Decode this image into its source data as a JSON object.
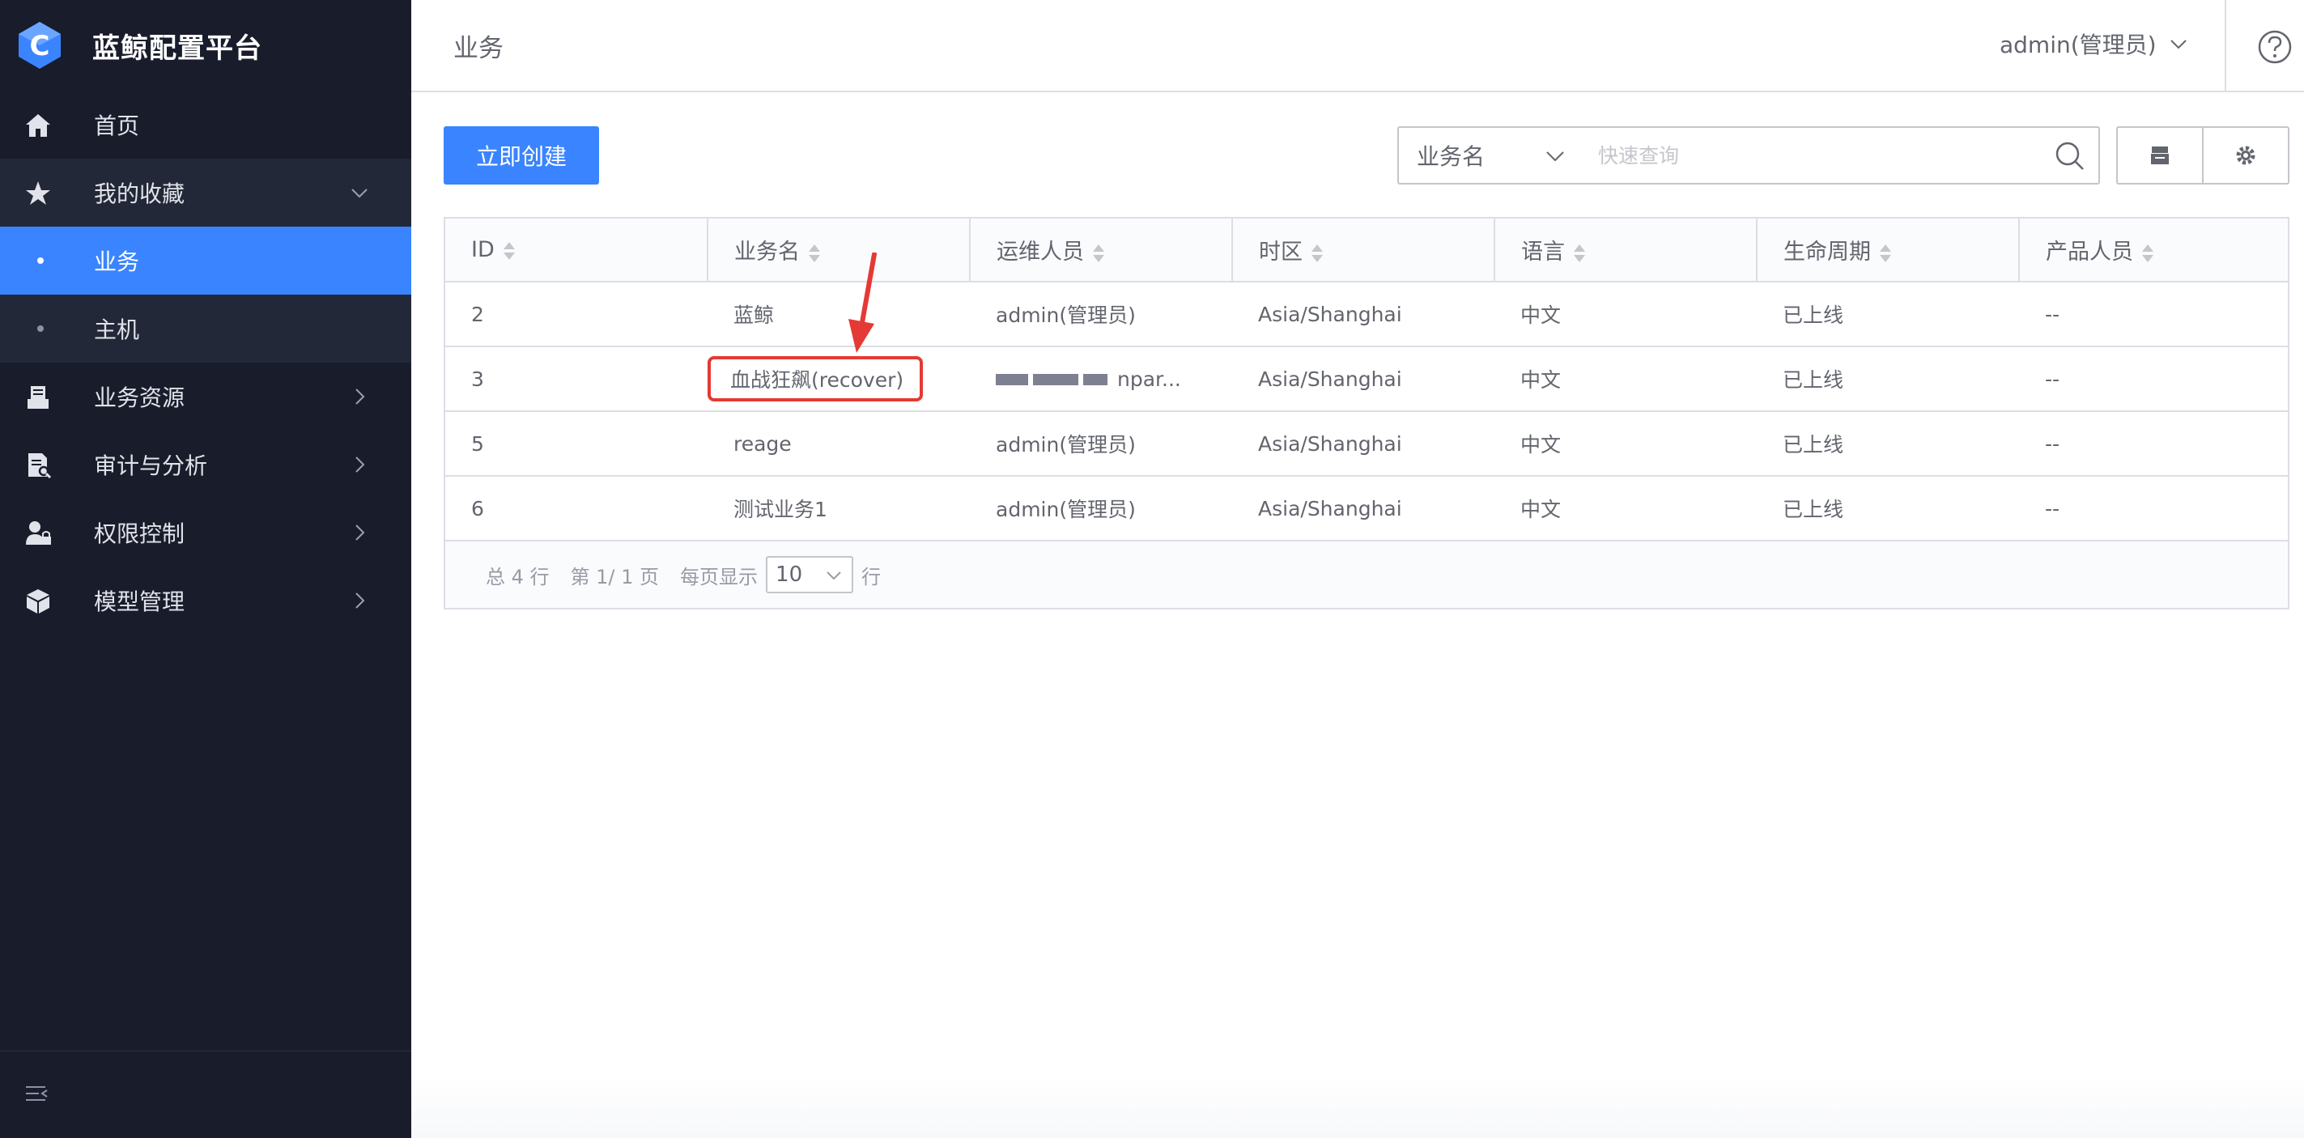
{
  "app": {
    "title": "蓝鲸配置平台"
  },
  "sidebar": {
    "items": [
      {
        "label": "首页",
        "icon": "home-icon"
      },
      {
        "label": "我的收藏",
        "icon": "star-icon"
      },
      {
        "label": "业务",
        "icon": "dot"
      },
      {
        "label": "主机",
        "icon": "dot"
      },
      {
        "label": "业务资源",
        "icon": "business-resource-icon"
      },
      {
        "label": "审计与分析",
        "icon": "audit-icon"
      },
      {
        "label": "权限控制",
        "icon": "permission-lock-icon"
      },
      {
        "label": "模型管理",
        "icon": "cube-icon"
      }
    ],
    "active": "业务"
  },
  "header": {
    "title": "业务",
    "user": "admin(管理员)"
  },
  "toolbar": {
    "create_label": "立即创建",
    "filter_selected": "业务名",
    "search_placeholder": "快速查询"
  },
  "table": {
    "columns": [
      "ID",
      "业务名",
      "运维人员",
      "时区",
      "语言",
      "生命周期",
      "产品人员"
    ],
    "rows": [
      [
        "2",
        "蓝鲸",
        "admin(管理员)",
        "Asia/Shanghai",
        "中文",
        "已上线",
        "--"
      ],
      [
        "3",
        "血战狂飙(recover)",
        "npar...",
        "Asia/Shanghai",
        "中文",
        "已上线",
        "--"
      ],
      [
        "5",
        "reage",
        "admin(管理员)",
        "Asia/Shanghai",
        "中文",
        "已上线",
        "--"
      ],
      [
        "6",
        "测试业务1",
        "admin(管理员)",
        "Asia/Shanghai",
        "中文",
        "已上线",
        "--"
      ]
    ]
  },
  "pagination": {
    "total": "总 4 行",
    "page": "第 1/ 1 页",
    "per_page_label": "每页显示",
    "page_size": "10",
    "unit": "行"
  },
  "colors": {
    "accent": "#3a84ff",
    "sidebar_bg": "#191c2b",
    "highlight": "#e53935"
  }
}
